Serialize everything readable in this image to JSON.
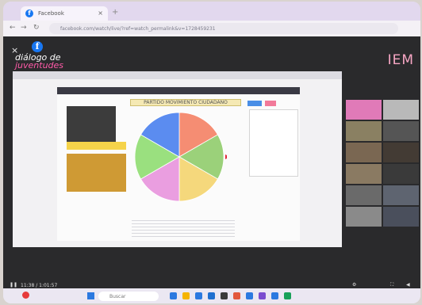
{
  "browser": {
    "tab_title": "Facebook",
    "new_tab_symbol": "+",
    "url": "facebook.com/watch/live/?ref=watch_permalink&v=1728459231"
  },
  "viewer": {
    "close_symbol": "×",
    "fb_symbol": "f",
    "brand_line1": "diálogo de",
    "brand_line2": "juventudes",
    "corner_logo": "IEM"
  },
  "presentation": {
    "wheel_title": "PARTIDO MOVIMIENTO CIUDADANO",
    "wheel_colors": [
      "#f58d73",
      "#9bd17a",
      "#f5d87c",
      "#ea9ee0",
      "#9ae07f",
      "#5b8cf0"
    ]
  },
  "participants": {
    "tile_colors": [
      "#e07ab8",
      "#b9b9b9",
      "#8a8062",
      "#555555",
      "#7a6752",
      "#433b34",
      "#8a7a62",
      "#3a3a3a",
      "#6a6a6a",
      "#5e6470",
      "#8a8a8a",
      "#4a4f5c"
    ]
  },
  "controls": {
    "time": "11:38 / 1:01:57"
  },
  "taskbar": {
    "search_placeholder": "Buscar",
    "icon_colors": [
      "#2b79e0",
      "#f5b400",
      "#2b79e0",
      "#1f6fd0",
      "#3a3a3a",
      "#e2573d",
      "#2b79e0",
      "#7a4ccf",
      "#2b79e0",
      "#18a058"
    ]
  }
}
